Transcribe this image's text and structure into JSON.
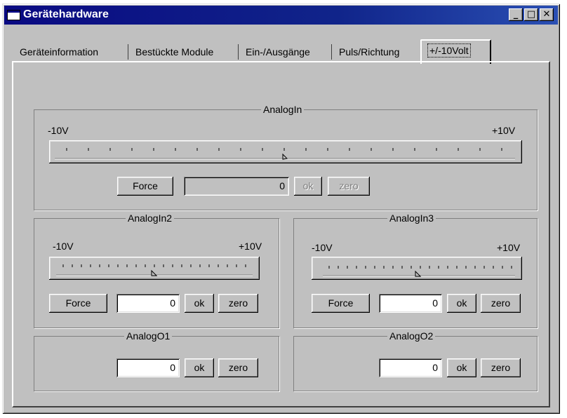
{
  "window": {
    "title": "Gerätehardware",
    "controls": {
      "minimize": "_",
      "maximize": "□",
      "close": "✕"
    }
  },
  "tabs": [
    {
      "label": "Geräteinformation",
      "active": false
    },
    {
      "label": "Bestückte Module",
      "active": false
    },
    {
      "label": "Ein-/Ausgänge",
      "active": false
    },
    {
      "label": "Puls/Richtung",
      "active": false
    },
    {
      "label": "+/-10Volt",
      "active": true
    }
  ],
  "analogIn": {
    "title": "AnalogIn",
    "min_label": "-10V",
    "max_label": "+10V",
    "slider_position": 0.5,
    "force_label": "Force",
    "value": "0",
    "ok_label": "ok",
    "zero_label": "zero"
  },
  "analogIn2": {
    "title": "AnalogIn2",
    "min_label": "-10V",
    "max_label": "+10V",
    "slider_position": 0.5,
    "force_label": "Force",
    "value": "0",
    "ok_label": "ok",
    "zero_label": "zero"
  },
  "analogIn3": {
    "title": "AnalogIn3",
    "min_label": "-10V",
    "max_label": "+10V",
    "slider_position": 0.5,
    "force_label": "Force",
    "value": "0",
    "ok_label": "ok",
    "zero_label": "zero"
  },
  "analogOut1": {
    "title": "AnalogO1",
    "value": "0",
    "ok_label": "ok",
    "zero_label": "zero"
  },
  "analogOut2": {
    "title": "AnalogO2",
    "value": "0",
    "ok_label": "ok",
    "zero_label": "zero"
  }
}
